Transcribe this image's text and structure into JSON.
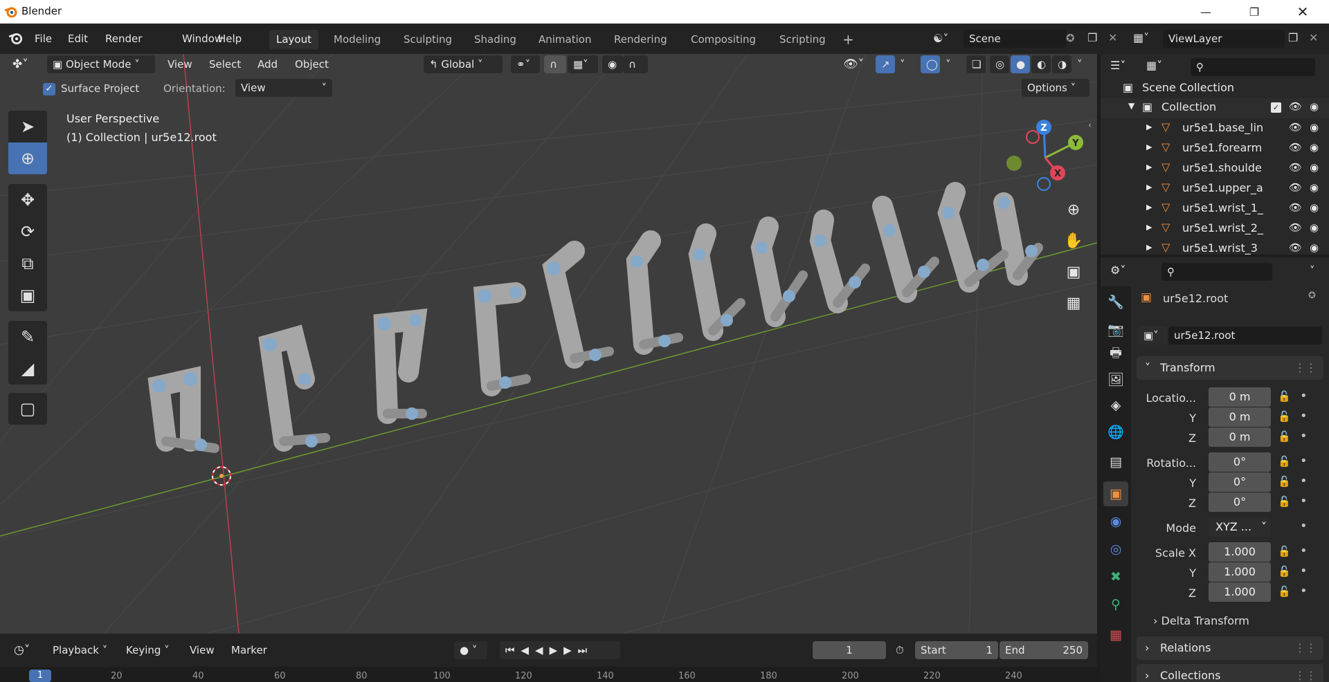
{
  "titlebar": {
    "logo_icon": "blender-logo-icon",
    "title": "Blender"
  },
  "menus": [
    "File",
    "Edit",
    "Render",
    "Window",
    "Help"
  ],
  "workspaces": [
    "Layout",
    "Modeling",
    "Sculpting",
    "Shading",
    "Animation",
    "Rendering",
    "Compositing",
    "Scripting"
  ],
  "active_workspace": "Layout",
  "add_workspace": "+",
  "scene": {
    "value": "Scene"
  },
  "view_layer": {
    "value": "ViewLayer"
  },
  "viewport_header": {
    "mode": "Object Mode",
    "menus": [
      "View",
      "Select",
      "Add",
      "Object"
    ],
    "orientation": "Global"
  },
  "tool_settings": {
    "surface_project": "Surface Project",
    "orientation_label": "Orientation:",
    "orientation_value": "View",
    "options": "Options"
  },
  "viewport_info": {
    "line1": "User Perspective",
    "line2": "(1) Collection | ur5e12.root"
  },
  "gizmo": {
    "x": "X",
    "y": "Y",
    "z": "Z"
  },
  "timeline": {
    "playback": "Playback",
    "keying": "Keying",
    "view": "View",
    "marker": "Marker",
    "current_frame": "1",
    "start_label": "Start",
    "start_value": "1",
    "end_label": "End",
    "end_value": "250",
    "ruler": [
      "1",
      "20",
      "40",
      "60",
      "80",
      "100",
      "120",
      "140",
      "160",
      "180",
      "200",
      "220",
      "240"
    ]
  },
  "outliner": {
    "root": "Scene Collection",
    "collection": "Collection",
    "items": [
      "ur5e1.base_lin",
      "ur5e1.forearm",
      "ur5e1.shoulde",
      "ur5e1.upper_a",
      "ur5e1.wrist_1_",
      "ur5e1.wrist_2_",
      "ur5e1.wrist_3"
    ]
  },
  "properties": {
    "object_name": "ur5e12.root",
    "datablock_name": "ur5e12.root",
    "transform_header": "Transform",
    "location_label": "Locatio...",
    "location": [
      "0 m",
      "0 m",
      "0 m"
    ],
    "rotation_label": "Rotatio...",
    "rotation": [
      "0°",
      "0°",
      "0°"
    ],
    "axis_labels": [
      "Y",
      "Z"
    ],
    "mode_label": "Mode",
    "mode_value": "XYZ ...",
    "scale_label": "Scale X",
    "scale": [
      "1.000",
      "1.000",
      "1.000"
    ],
    "delta_transform": "Delta Transform",
    "relations": "Relations",
    "collections": "Collections"
  },
  "colors": {
    "accent": "#4772b3",
    "x_axis": "#e2455a",
    "y_axis": "#8cbb3a",
    "z_axis": "#3b82e0",
    "bg": "#3d3d3d"
  }
}
